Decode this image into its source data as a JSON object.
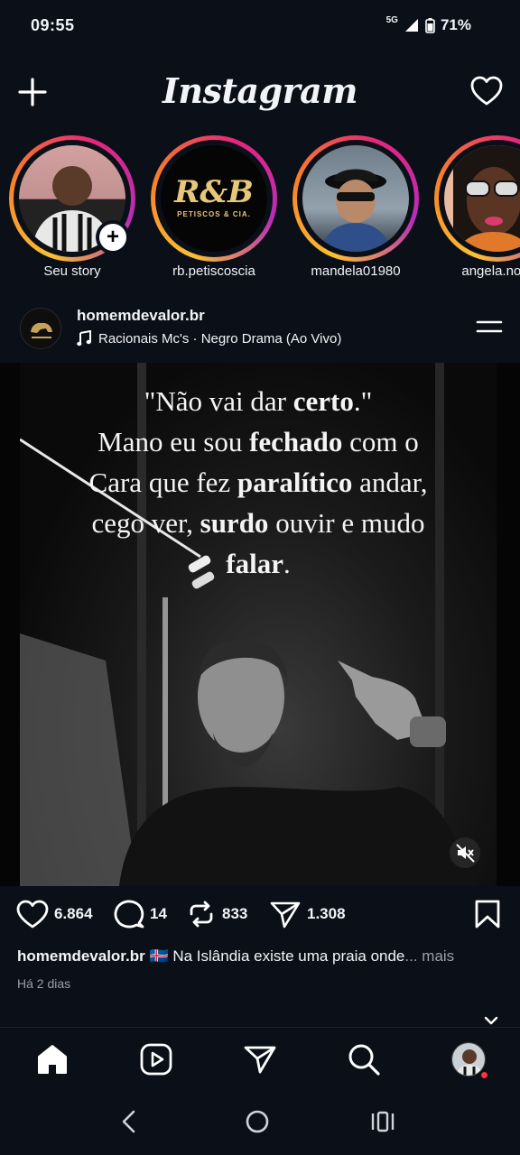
{
  "status_bar": {
    "time": "09:55",
    "network": "5G",
    "battery": "71%"
  },
  "app": {
    "brand": "Instagram"
  },
  "stories": [
    {
      "label": "Seu story"
    },
    {
      "label": "rb.petiscoscia",
      "logo_text": "R&B",
      "logo_sub": "PETISCOS & CIA."
    },
    {
      "label": "mandela01980"
    },
    {
      "label": "angela.nora"
    }
  ],
  "post": {
    "username": "homemdevalor.br",
    "music": "Racionais Mc's · Negro Drama (Ao Vivo)",
    "quote": {
      "l1_a": "\"Não vai dar ",
      "l1_b": "certo",
      "l1_c": ".\"",
      "l2_a": "Mano eu sou ",
      "l2_b": "fechado",
      "l2_c": " com o",
      "l3_a": "Cara que fez ",
      "l3_b": "paralítico",
      "l3_c": " andar,",
      "l4_a": "cego ver, ",
      "l4_b": "surdo",
      "l4_c": " ouvir e mudo",
      "l5_b": "falar",
      "l5_c": "."
    },
    "likes": "6.864",
    "comments": "14",
    "reposts": "833",
    "shares": "1.308",
    "caption_user": "homemdevalor.br",
    "caption_flag": "🇮🇸",
    "caption_text": " Na Islândia existe uma praia onde",
    "caption_more": "... mais",
    "time_ago": "Há 2 dias"
  },
  "colors": {
    "background": "#0b0f17",
    "notification_dot": "#ff3040"
  }
}
